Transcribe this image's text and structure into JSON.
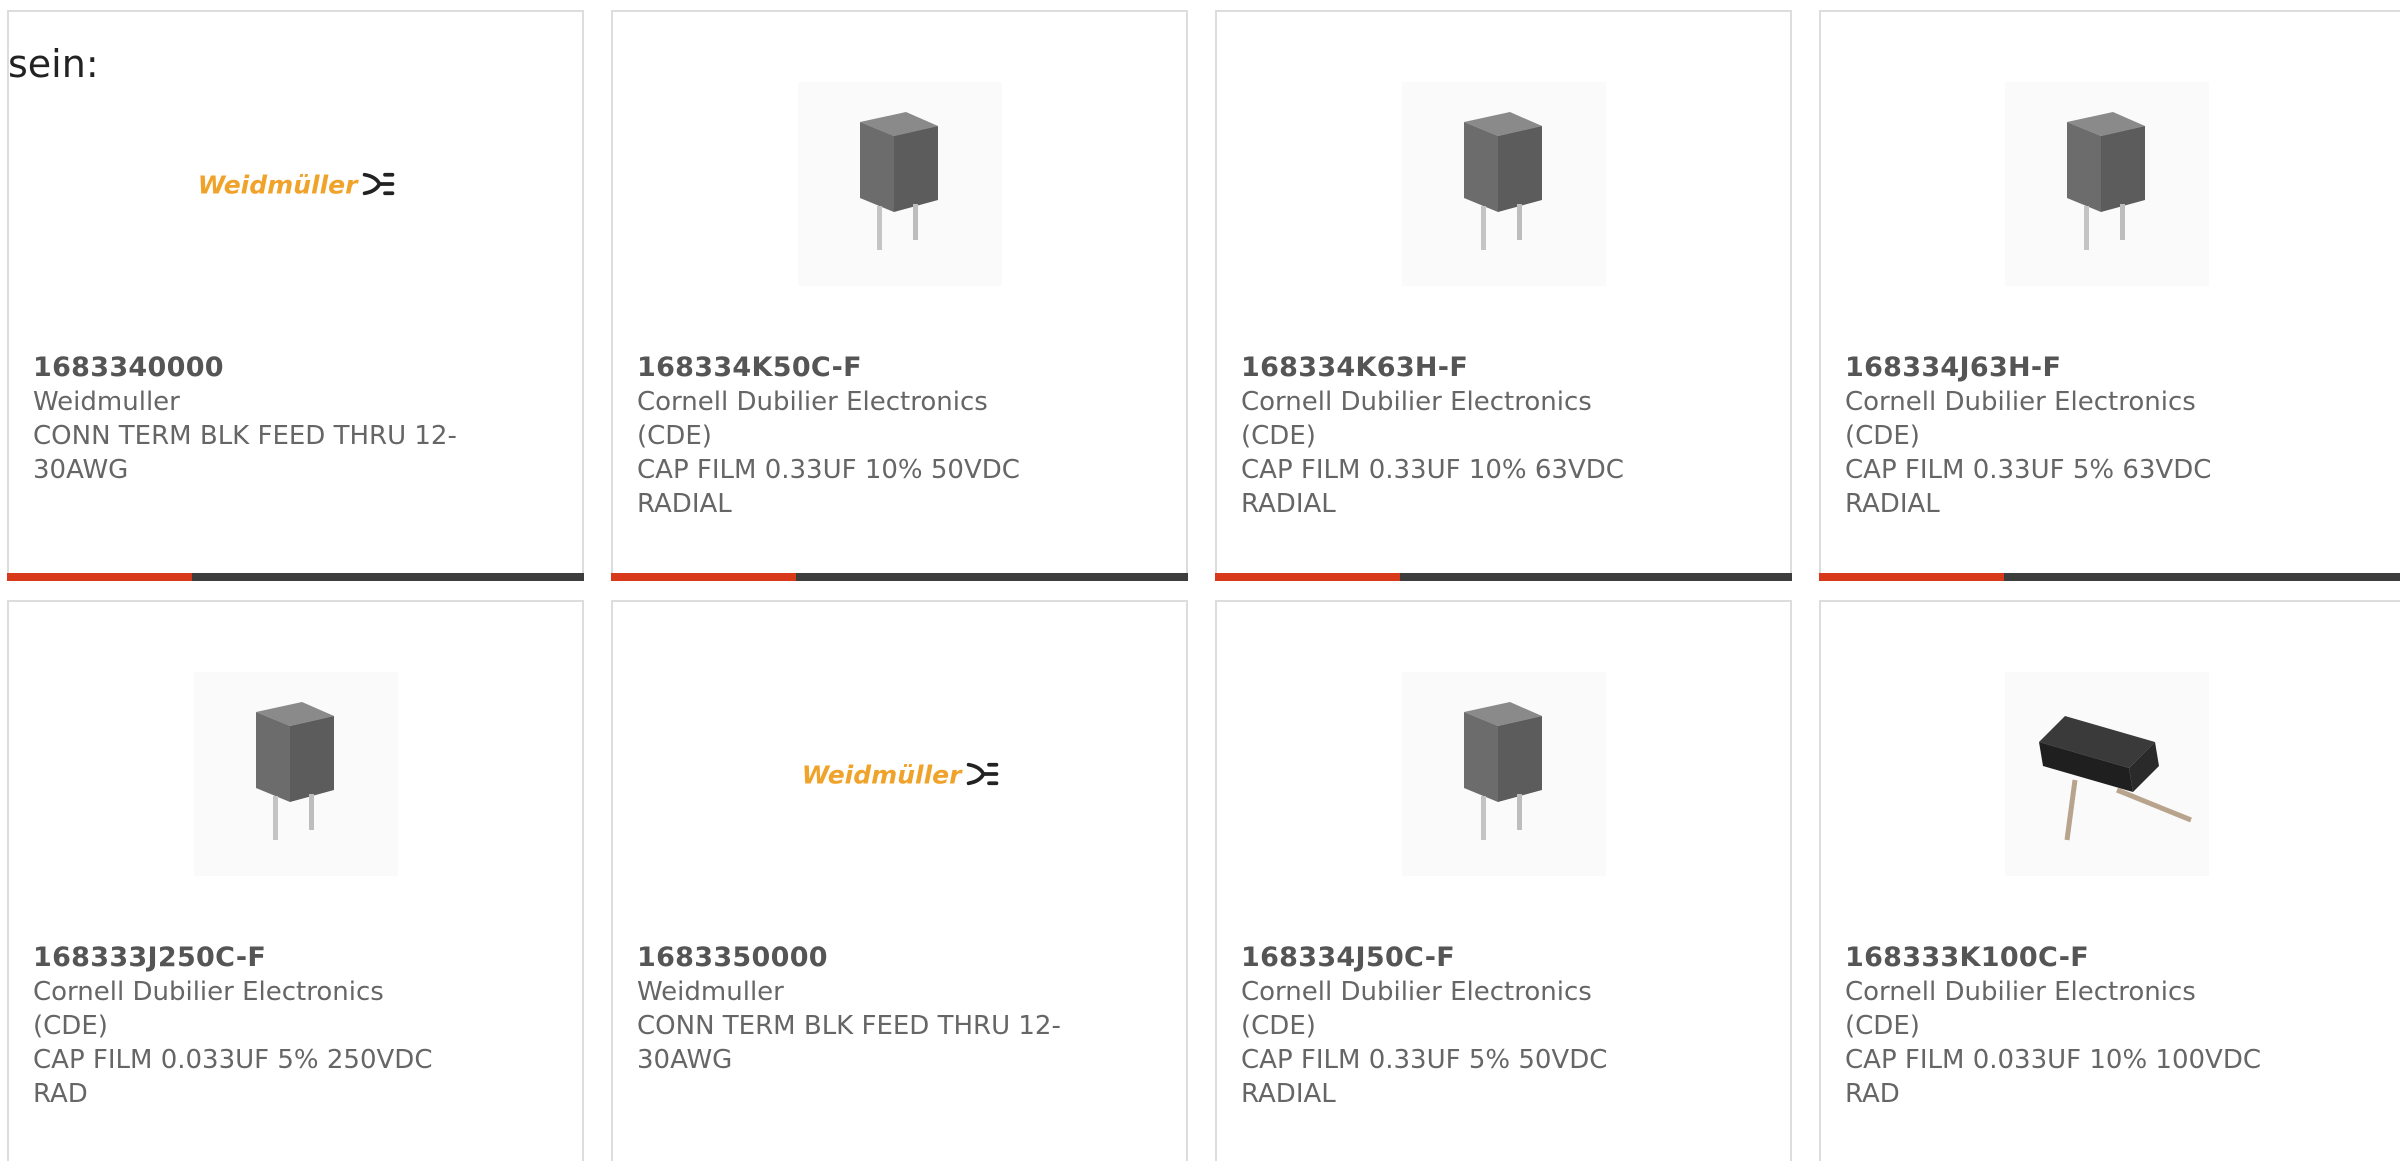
{
  "intro_text": "sein:",
  "colors": {
    "accent": "#d7391a",
    "bar": "#3d3d3d",
    "border": "#dddddd",
    "text": "#666666",
    "logo": "#f0a32b"
  },
  "products": [
    {
      "part_number": "1683340000",
      "manufacturer": "Weidmuller",
      "description_line1": "CONN TERM BLK FEED THRU 12-",
      "description_line2": "30AWG",
      "image_type": "weidmuller-logo",
      "logo_text": "Weidmüller"
    },
    {
      "part_number": "168334K50C-F",
      "manufacturer": "Cornell Dubilier Electronics (CDE)",
      "description_line1": "CAP FILM 0.33UF 10% 50VDC",
      "description_line2": "RADIAL",
      "image_type": "capacitor-box-icon"
    },
    {
      "part_number": "168334K63H-F",
      "manufacturer": "Cornell Dubilier Electronics (CDE)",
      "description_line1": "CAP FILM 0.33UF 10% 63VDC",
      "description_line2": "RADIAL",
      "image_type": "capacitor-box-icon"
    },
    {
      "part_number": "168334J63H-F",
      "manufacturer": "Cornell Dubilier Electronics (CDE)",
      "description_line1": "CAP FILM 0.33UF 5% 63VDC",
      "description_line2": "RADIAL",
      "image_type": "capacitor-box-icon"
    },
    {
      "part_number": "168333J250C-F",
      "manufacturer": "Cornell Dubilier Electronics (CDE)",
      "description_line1": "CAP FILM 0.033UF 5% 250VDC",
      "description_line2": "RAD",
      "image_type": "capacitor-box-icon"
    },
    {
      "part_number": "1683350000",
      "manufacturer": "Weidmuller",
      "description_line1": "CONN TERM BLK FEED THRU 12-",
      "description_line2": "30AWG",
      "image_type": "weidmuller-logo",
      "logo_text": "Weidmüller"
    },
    {
      "part_number": "168334J50C-F",
      "manufacturer": "Cornell Dubilier Electronics (CDE)",
      "description_line1": "CAP FILM 0.33UF 5% 50VDC",
      "description_line2": "RADIAL",
      "image_type": "capacitor-box-icon"
    },
    {
      "part_number": "168333K100C-F",
      "manufacturer": "Cornell Dubilier Electronics (CDE)",
      "description_line1": "CAP FILM 0.033UF 10% 100VDC",
      "description_line2": "RAD",
      "image_type": "capacitor-flat-icon"
    }
  ]
}
